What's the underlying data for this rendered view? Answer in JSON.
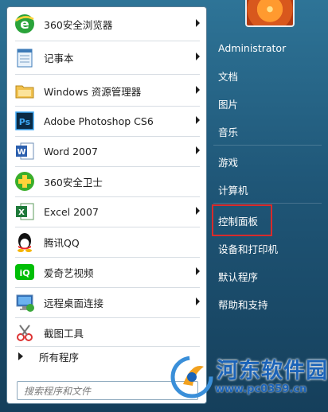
{
  "programs": [
    {
      "icon": "360-browser-icon",
      "label": "360安全浏览器",
      "arrow": true
    },
    {
      "icon": "notepad-icon",
      "label": "记事本",
      "arrow": true
    },
    {
      "icon": "folder-explorer-icon",
      "label": "Windows 资源管理器",
      "arrow": true
    },
    {
      "icon": "photoshop-icon",
      "label": "Adobe Photoshop CS6",
      "arrow": true
    },
    {
      "icon": "word-icon",
      "label": "Word 2007",
      "arrow": true
    },
    {
      "icon": "360-guard-icon",
      "label": "360安全卫士",
      "arrow": false
    },
    {
      "icon": "excel-icon",
      "label": "Excel 2007",
      "arrow": true
    },
    {
      "icon": "qq-icon",
      "label": "腾讯QQ",
      "arrow": false
    },
    {
      "icon": "iqiyi-icon",
      "label": "爱奇艺视频",
      "arrow": true
    },
    {
      "icon": "remote-desktop-icon",
      "label": "远程桌面连接",
      "arrow": true
    },
    {
      "icon": "snipping-tool-icon",
      "label": "截图工具",
      "arrow": false
    }
  ],
  "all_programs": "所有程序",
  "search": {
    "placeholder": "搜索程序和文件"
  },
  "right_items": [
    "Administrator",
    "文档",
    "图片",
    "音乐",
    "游戏",
    "计算机",
    "控制面板",
    "设备和打印机",
    "默认程序",
    "帮助和支持"
  ],
  "highlighted_item": "控制面板",
  "watermark": {
    "title": "河东软件园",
    "url": "www.pc0359.cn"
  },
  "colors": {
    "highlight_border": "#d92b2b",
    "watermark_blue": "#1b63b8",
    "panel_bg": "#1f5677"
  }
}
